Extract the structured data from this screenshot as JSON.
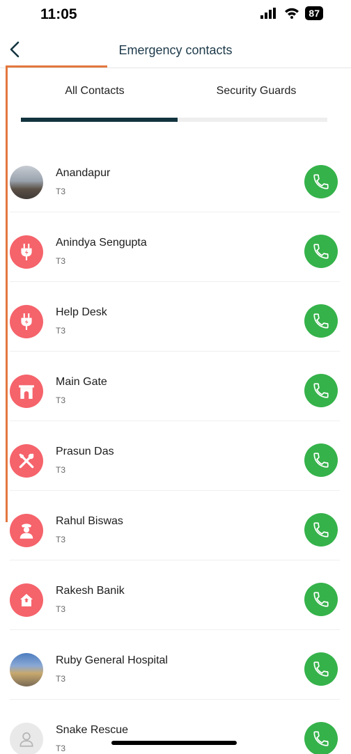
{
  "status": {
    "time": "11:05",
    "battery": "87"
  },
  "header": {
    "title": "Emergency contacts"
  },
  "tabs": [
    {
      "label": "All Contacts",
      "active": true
    },
    {
      "label": "Security Guards",
      "active": false
    }
  ],
  "colors": {
    "accent": "#12343f",
    "call_green": "#35b24a",
    "avatar_pink": "#f5636b",
    "highlight": "#e2773d"
  },
  "contacts": [
    {
      "name": "Anandapur",
      "sub": "T3",
      "avatar": "photo"
    },
    {
      "name": "Anindya Sengupta",
      "sub": "T3",
      "avatar": "plug-icon"
    },
    {
      "name": "Help Desk",
      "sub": "T3",
      "avatar": "plug-icon"
    },
    {
      "name": "Main Gate",
      "sub": "T3",
      "avatar": "gate-icon"
    },
    {
      "name": "Prasun Das",
      "sub": "T3",
      "avatar": "tools-icon"
    },
    {
      "name": "Rahul Biswas",
      "sub": "T3",
      "avatar": "guard-icon"
    },
    {
      "name": "Rakesh Banik",
      "sub": "T3",
      "avatar": "house-icon"
    },
    {
      "name": "Ruby General Hospital",
      "sub": "T3",
      "avatar": "photo"
    },
    {
      "name": "Snake Rescue",
      "sub": "T3",
      "avatar": "person-icon"
    }
  ]
}
